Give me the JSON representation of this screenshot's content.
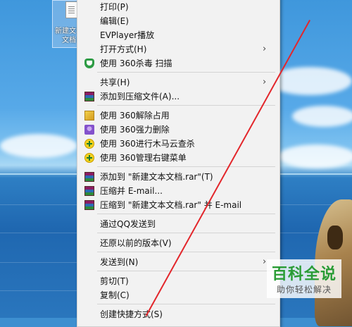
{
  "desktop": {
    "icon_label": "新建文本文档"
  },
  "menu": {
    "items": [
      {
        "label": "打印(P)",
        "icon": "",
        "submenu": false
      },
      {
        "label": "编辑(E)",
        "icon": "",
        "submenu": false
      },
      {
        "label": "EVPlayer播放",
        "icon": "",
        "submenu": false
      },
      {
        "label": "打开方式(H)",
        "icon": "",
        "submenu": true
      },
      {
        "label": "使用 360杀毒 扫描",
        "icon": "shield-360-icon",
        "submenu": false
      },
      {
        "label": "共享(H)",
        "icon": "",
        "submenu": true
      },
      {
        "label": "添加到压缩文件(A)...",
        "icon": "winrar-icon",
        "submenu": false
      },
      {
        "label": "使用 360解除占用",
        "icon": "unlock-icon",
        "submenu": false
      },
      {
        "label": "使用 360强力删除",
        "icon": "force-delete-icon",
        "submenu": false
      },
      {
        "label": "使用 360进行木马云查杀",
        "icon": "360-plus-icon",
        "submenu": false
      },
      {
        "label": "使用 360管理右键菜单",
        "icon": "360-plus-icon",
        "submenu": false
      },
      {
        "label": "添加到 \"新建文本文档.rar\"(T)",
        "icon": "winrar-icon",
        "submenu": false
      },
      {
        "label": "压缩并 E-mail...",
        "icon": "winrar-icon",
        "submenu": false
      },
      {
        "label": "压缩到 \"新建文本文档.rar\" 并 E-mail",
        "icon": "winrar-icon",
        "submenu": false
      },
      {
        "label": "通过QQ发送到",
        "icon": "",
        "submenu": false
      },
      {
        "label": "还原以前的版本(V)",
        "icon": "",
        "submenu": false
      },
      {
        "label": "发送到(N)",
        "icon": "",
        "submenu": true
      },
      {
        "label": "剪切(T)",
        "icon": "",
        "submenu": false
      },
      {
        "label": "复制(C)",
        "icon": "",
        "submenu": false
      },
      {
        "label": "创建快捷方式(S)",
        "icon": "",
        "submenu": false
      }
    ],
    "submenu_arrow": "›"
  },
  "watermark": {
    "title": "百科全说",
    "subtitle": "助你轻松解决"
  },
  "colors": {
    "menu_bg": "#f2f2f2",
    "annotation_line": "#e3262b",
    "watermark_green": "#2a9c35"
  }
}
